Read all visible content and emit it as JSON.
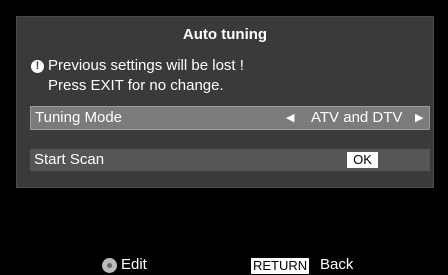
{
  "dialog": {
    "title": "Auto tuning",
    "warning_line1": "Previous settings will be lost !",
    "warning_line2": "Press EXIT for no change."
  },
  "tuning_mode": {
    "label": "Tuning Mode",
    "value": "ATV and DTV"
  },
  "start_scan": {
    "label": "Start Scan",
    "button": "OK"
  },
  "footer": {
    "edit_label": "Edit",
    "return_key": "RETURN",
    "back_label": "Back"
  }
}
